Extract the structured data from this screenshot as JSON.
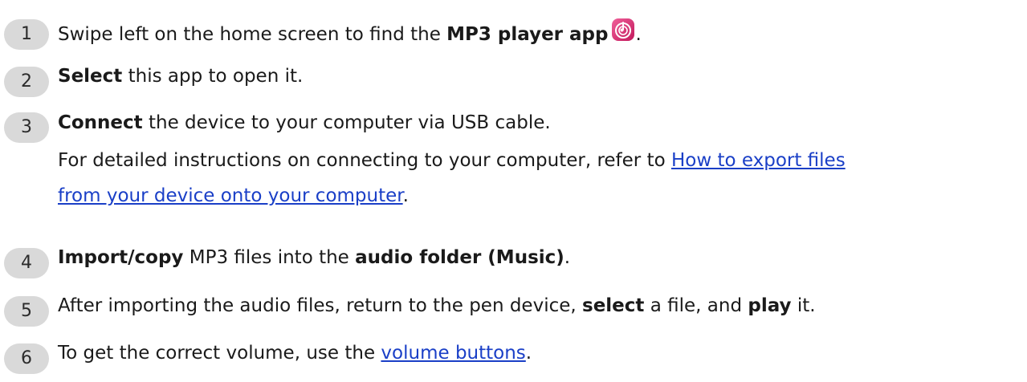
{
  "steps": [
    {
      "number": "1",
      "text_a": "Swipe left on the home screen to find the ",
      "bold_a": "MP3 player app",
      "text_b": "."
    },
    {
      "number": "2",
      "bold_a": "Select",
      "text_a": " this app to open it."
    },
    {
      "number": "3",
      "bold_a": "Connect",
      "text_a": " the device to your computer via USB cable.",
      "line2_text": "For detailed instructions on connecting to your computer, refer to ",
      "link_part1": "How to export files",
      "link_part2": "from your device onto your computer",
      "line3_text": "."
    },
    {
      "number": "4",
      "bold_a": "Import/copy",
      "text_a": " MP3 files into the ",
      "bold_b": "audio folder (Music)",
      "text_b": "."
    },
    {
      "number": "5",
      "text_a": "After importing the audio files, return to the pen device, ",
      "bold_a": "select",
      "text_b": " a file, and ",
      "bold_b": "play",
      "text_c": " it."
    },
    {
      "number": "6",
      "text_a": "To get the correct volume, use the ",
      "link": "volume buttons",
      "text_b": "."
    }
  ],
  "colors": {
    "badge_bg": "#d9d9d9",
    "link": "#1a3fc7",
    "app_icon_gradient_start": "#e8508a",
    "app_icon_gradient_end": "#c2185b"
  },
  "icons": {
    "app_icon": "mp3-player-app-icon"
  }
}
